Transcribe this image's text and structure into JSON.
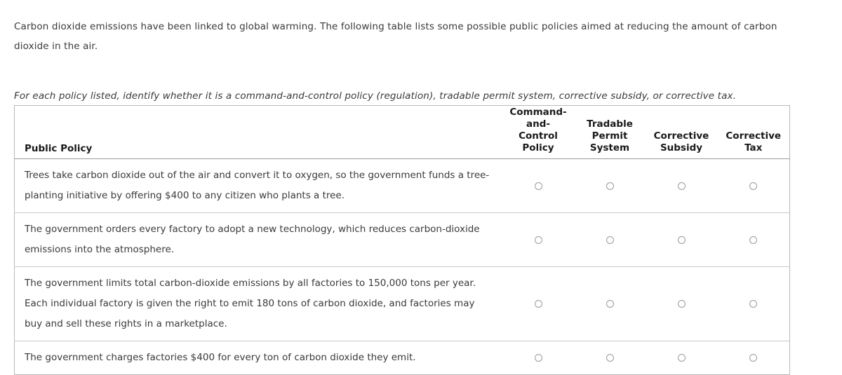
{
  "intro": {
    "paragraph": "Carbon dioxide emissions have been linked to global warming. The following table lists some possible public policies aimed at reducing the amount of carbon dioxide in the air.",
    "instruction": "For each policy listed, identify whether it is a command-and-control policy (regulation), tradable permit system, corrective subsidy, or corrective tax."
  },
  "table": {
    "headers": {
      "policy": "Public Policy",
      "command_and_control": "Command-and-Control Policy",
      "command_and_control_lines": [
        "Command-",
        "and-",
        "Control",
        "Policy"
      ],
      "tradable_permit": "Tradable Permit System",
      "tradable_permit_lines": [
        "Tradable",
        "Permit",
        "System"
      ],
      "corrective_subsidy": "Corrective Subsidy",
      "corrective_subsidy_lines": [
        "Corrective",
        "Subsidy"
      ],
      "corrective_tax": "Corrective Tax",
      "corrective_tax_lines": [
        "Corrective",
        "Tax"
      ]
    },
    "rows": [
      {
        "policy": "Trees take carbon dioxide out of the air and convert it to oxygen, so the government funds a tree-planting initiative by offering $400 to any citizen who plants a tree.",
        "selected": null
      },
      {
        "policy": "The government orders every factory to adopt a new technology, which reduces carbon-dioxide emissions into the atmosphere.",
        "selected": null
      },
      {
        "policy": "The government limits total carbon-dioxide emissions by all factories to 150,000 tons per year. Each individual factory is given the right to emit 180 tons of carbon dioxide, and factories may buy and sell these rights in a marketplace.",
        "selected": null
      },
      {
        "policy": "The government charges factories $400 for every ton of carbon dioxide they emit.",
        "selected": null
      }
    ]
  },
  "colors": {
    "page_background": "#ffffff",
    "text": "#3a3a3a",
    "heading_text": "#1a1a1a",
    "table_border": "#b9b9b9",
    "row_divider": "#c9c9c9",
    "radio_border": "#9a9a9a"
  }
}
